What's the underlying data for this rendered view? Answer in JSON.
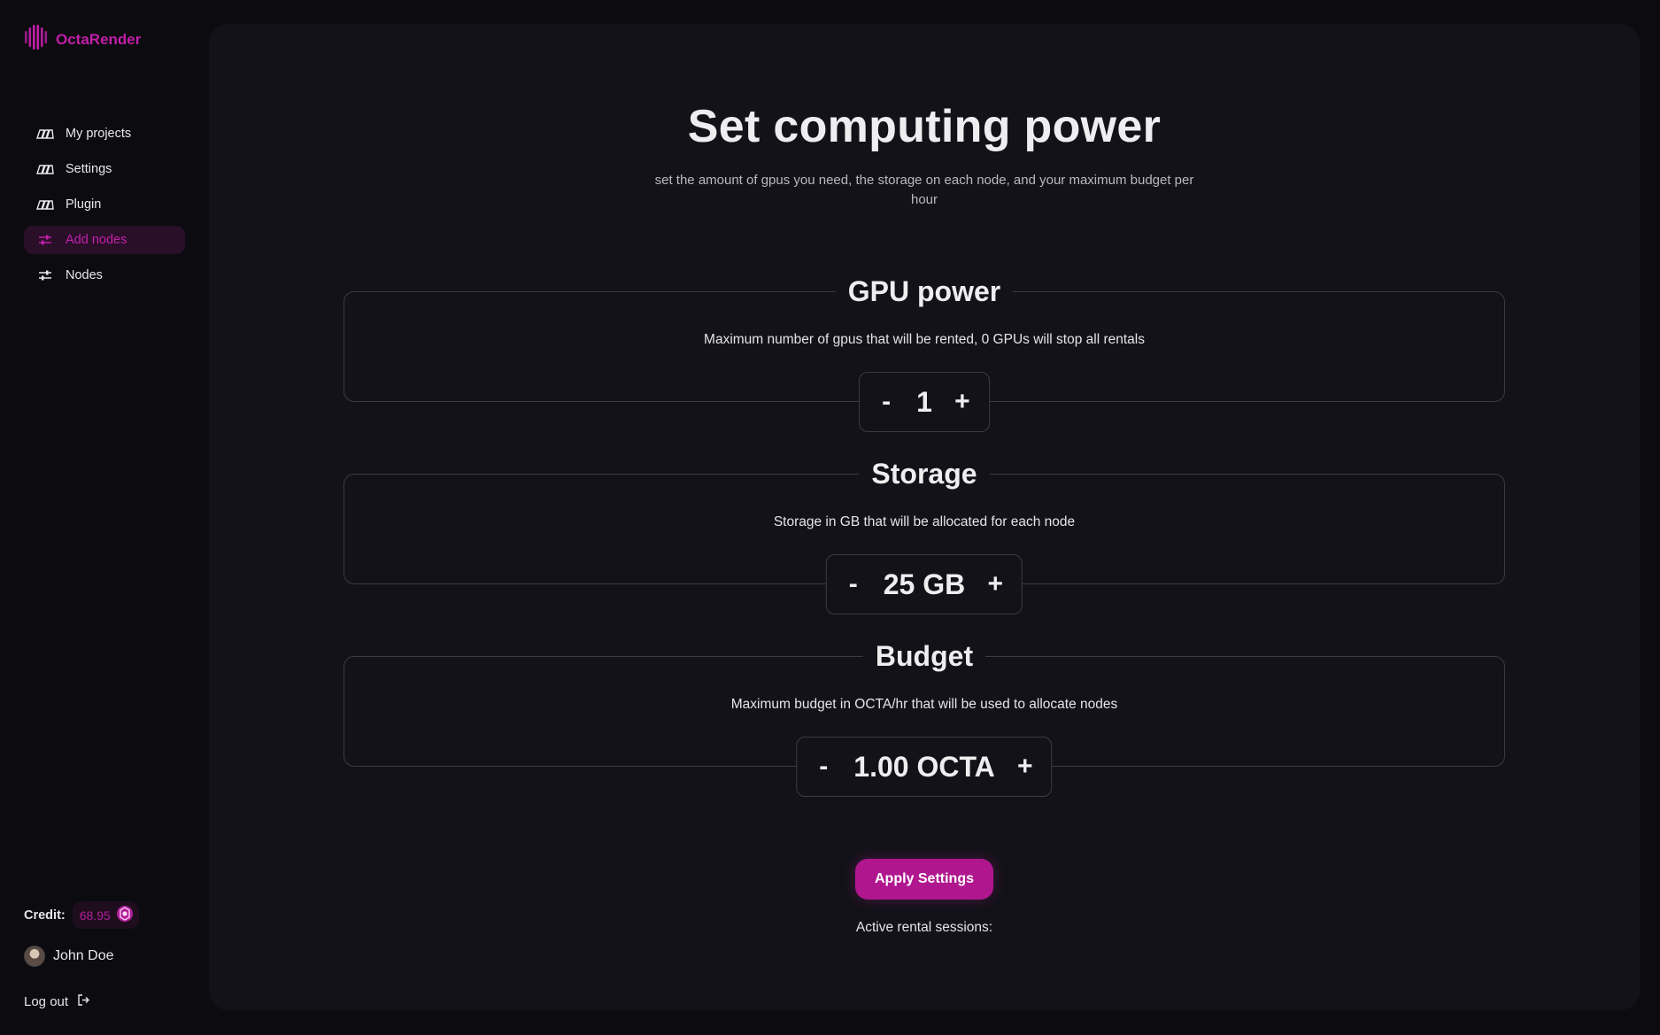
{
  "app": {
    "brand": "OctaRender"
  },
  "sidebar": {
    "items": [
      {
        "label": "My projects",
        "icon": "folder-stack-icon",
        "active": false
      },
      {
        "label": "Settings",
        "icon": "folder-stack-icon",
        "active": false
      },
      {
        "label": "Plugin",
        "icon": "folder-stack-icon",
        "active": false
      },
      {
        "label": "Add nodes",
        "icon": "sliders-icon",
        "active": true
      },
      {
        "label": "Nodes",
        "icon": "sliders-icon",
        "active": false
      }
    ],
    "credit_label": "Credit:",
    "credit_value": "68.95",
    "user_name": "John Doe",
    "logout_label": "Log out"
  },
  "main": {
    "title": "Set computing power",
    "subtitle": "set the amount of gpus you need, the storage on each node, and your maximum budget per hour",
    "sections": [
      {
        "title": "GPU power",
        "description": "Maximum number of gpus that will be rented, 0 GPUs will stop all rentals",
        "value": "1",
        "minus": "-",
        "plus": "+"
      },
      {
        "title": "Storage",
        "description": "Storage in GB that will be allocated for each node",
        "value": "25 GB",
        "minus": "-",
        "plus": "+"
      },
      {
        "title": "Budget",
        "description": "Maximum budget in OCTA/hr that will be used to allocate nodes",
        "value": "1.00 OCTA",
        "minus": "-",
        "plus": "+"
      }
    ],
    "apply_label": "Apply Settings",
    "sessions_label": "Active rental sessions:"
  },
  "colors": {
    "accent": "#c21fa9",
    "button": "#b0178f",
    "background": "#0b0b10",
    "panel": "#121218",
    "border": "#3b3b44"
  }
}
